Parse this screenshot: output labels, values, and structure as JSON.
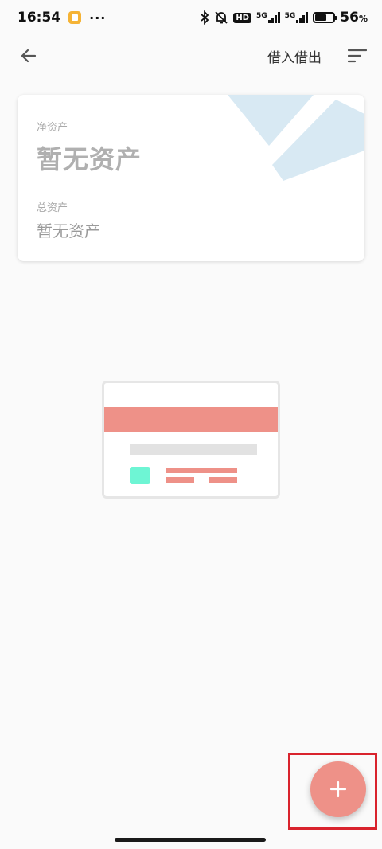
{
  "status_bar": {
    "time": "16:54",
    "dots": "···",
    "hd_label": "HD",
    "net1": "5G",
    "net2": "5G",
    "battery_percent": "56",
    "battery_unit": "%",
    "battery_level": 0.56
  },
  "app_bar": {
    "borrow_lend_label": "借入借出"
  },
  "asset_card": {
    "net_assets_label": "净资产",
    "net_assets_value": "暂无资产",
    "total_assets_label": "总资产",
    "total_assets_value": "暂无资产"
  },
  "colors": {
    "accent": "#ee9188",
    "deco_blue": "#d8e9f3",
    "illu_green": "#6ef5d4",
    "highlight_red": "#d9232d"
  },
  "icons": {
    "back": "arrow-left-icon",
    "sort": "sort-icon",
    "fab": "plus-icon"
  }
}
